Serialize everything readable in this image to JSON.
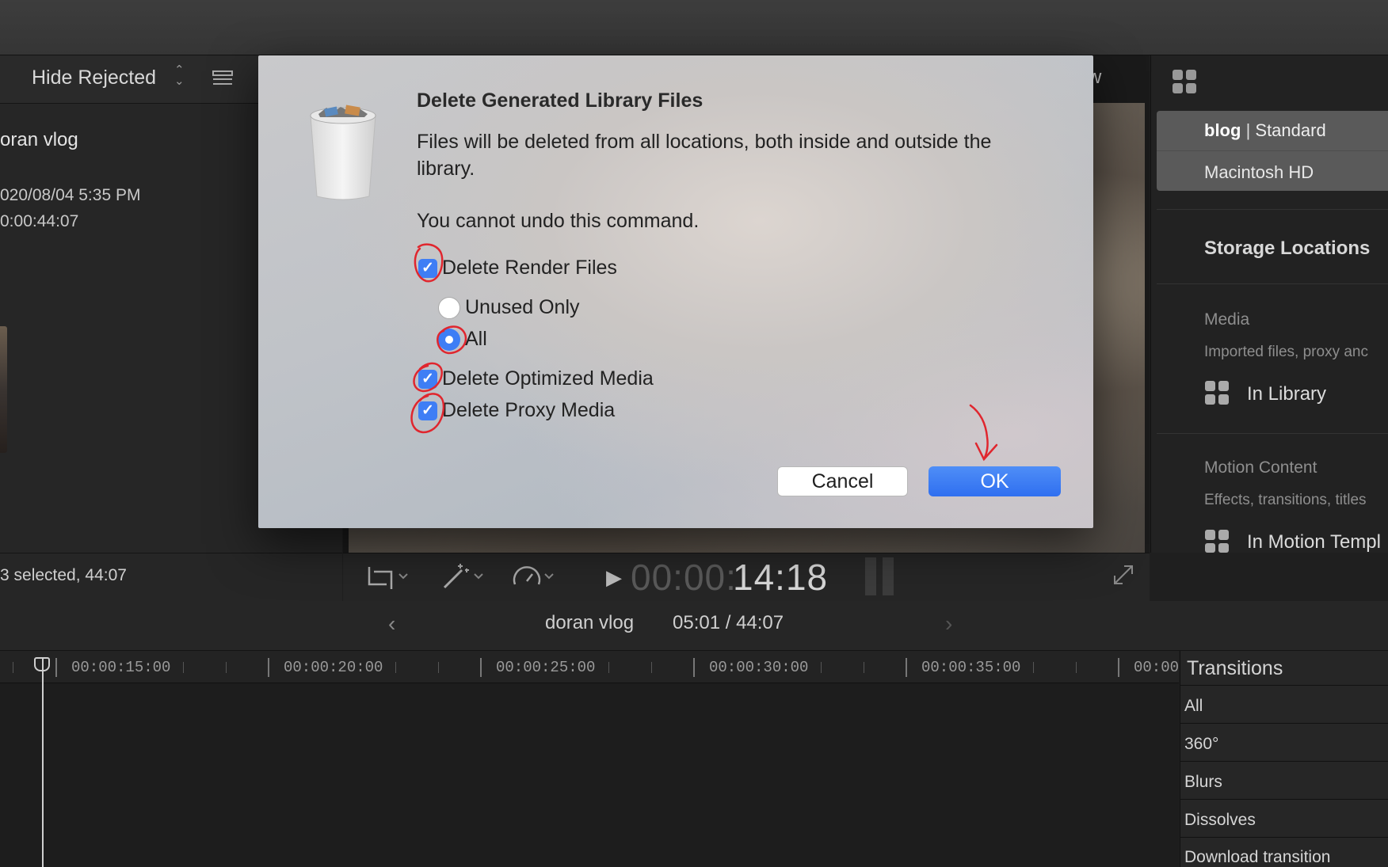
{
  "browser": {
    "filter_label": "Hide Rejected",
    "clip_name": "oran vlog",
    "clip_date": "020/08/04 5:35 PM",
    "clip_duration": "0:00:44:07",
    "selection_status": "3 selected, 44:07"
  },
  "viewer": {
    "partial_label": "w",
    "timecode_dim": "00:00:",
    "timecode_bright": "14:18"
  },
  "inspector": {
    "library_name": "blog",
    "library_format": "Standard",
    "library_volume": "Macintosh HD",
    "storage_title": "Storage Locations",
    "media_label": "Media",
    "media_desc": "Imported files, proxy anc",
    "media_value": "In Library",
    "motion_label": "Motion Content",
    "motion_desc": "Effects, transitions, titles",
    "motion_value": "In Motion Templ"
  },
  "timeline": {
    "project_name": "doran vlog",
    "position": "05:01 / 44:07",
    "ticks": [
      "00:00:15:00",
      "00:00:20:00",
      "00:00:25:00",
      "00:00:30:00",
      "00:00:35:00",
      "00:00:"
    ]
  },
  "transitions": {
    "title": "Transitions",
    "items": [
      "All",
      "360°",
      "Blurs",
      "Dissolves",
      "Download transition"
    ]
  },
  "dialog": {
    "title": "Delete Generated Library Files",
    "message": "Files will be deleted from all locations, both inside and outside the library.",
    "warning": "You cannot undo this command.",
    "delete_render": "Delete Render Files",
    "unused_only": "Unused Only",
    "all": "All",
    "delete_optimized": "Delete Optimized Media",
    "delete_proxy": "Delete Proxy Media",
    "cancel": "Cancel",
    "ok": "OK",
    "checkmark": "✓",
    "delete_render_checked": true,
    "render_scope_selected": "All",
    "delete_optimized_checked": true,
    "delete_proxy_checked": true
  },
  "colors": {
    "accent": "#3e7ef5",
    "annotation": "#e0262e"
  }
}
